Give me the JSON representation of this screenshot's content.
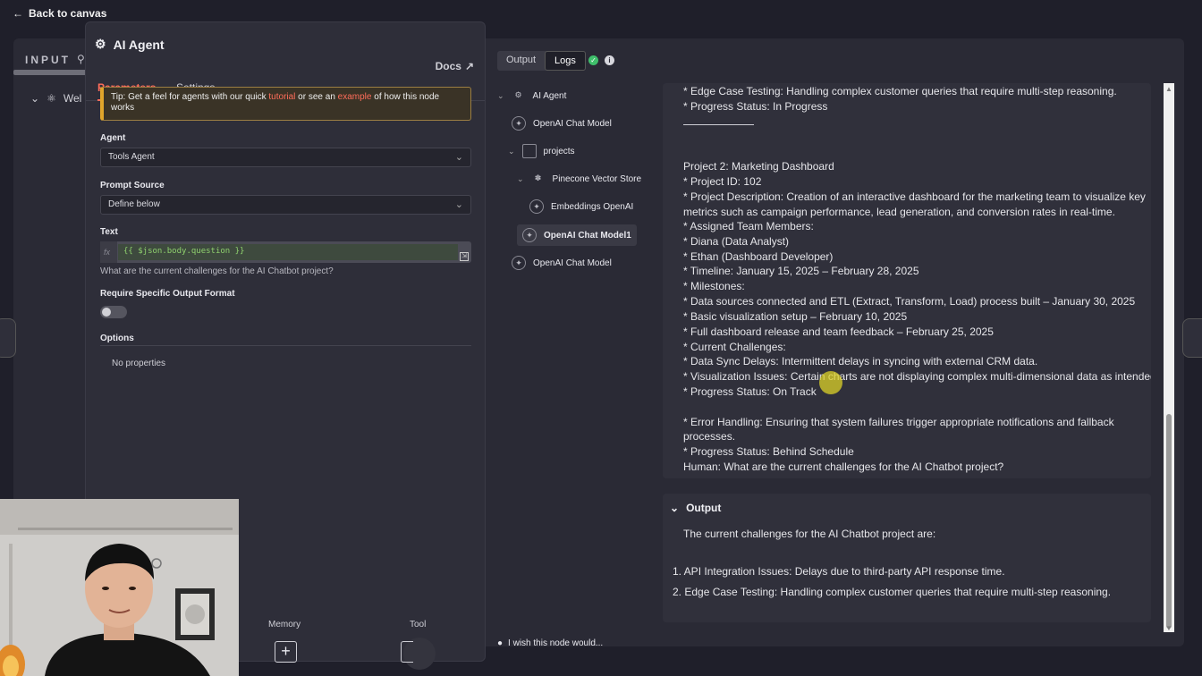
{
  "nav": {
    "back_label": "Back to canvas"
  },
  "input_panel": {
    "label": "INPUT",
    "row_label": "Wel"
  },
  "node": {
    "title": "AI Agent",
    "tabs": {
      "parameters": "Parameters",
      "settings": "Settings"
    },
    "docs_label": "Docs",
    "tip": {
      "prefix": "Tip: Get a feel for agents with our quick ",
      "link1": "tutorial",
      "middle": " or see an ",
      "link2": "example",
      "suffix": " of how this node works"
    },
    "agent": {
      "label": "Agent",
      "value": "Tools Agent"
    },
    "prompt_source": {
      "label": "Prompt Source",
      "value": "Define below"
    },
    "text": {
      "label": "Text",
      "fx": "fx",
      "expression": "{{ $json.body.question }}",
      "preview": "What are the current challenges for the AI Chatbot project?"
    },
    "require_format": {
      "label": "Require Specific Output Format"
    },
    "options": {
      "label": "Options",
      "empty": "No properties"
    },
    "memory_label": "Memory",
    "tool_label": "Tool",
    "add_symbol": "+"
  },
  "output": {
    "tabs": {
      "output": "Output",
      "logs": "Logs"
    },
    "tree": [
      {
        "label": "AI Agent"
      },
      {
        "label": "OpenAI Chat Model"
      },
      {
        "label": "projects"
      },
      {
        "label": "Pinecone Vector Store"
      },
      {
        "label": "Embeddings OpenAI"
      },
      {
        "label": "OpenAI Chat Model1"
      },
      {
        "label": "OpenAI Chat Model"
      }
    ],
    "log_lines": [
      "* Edge Case Testing: Handling complex customer queries that require multi-step reasoning.",
      "* Progress Status: In Progress",
      "Project 2: Marketing Dashboard",
      "* Project ID: 102",
      "* Project Description: Creation of an interactive dashboard for the marketing team to visualize key",
      "metrics such as campaign performance, lead generation, and conversion rates in real-time.",
      "* Assigned Team Members:",
      "* Diana (Data Analyst)",
      "* Ethan (Dashboard Developer)",
      "* Timeline: January 15, 2025 – February 28, 2025",
      "* Milestones:",
      "* Data sources connected and ETL (Extract, Transform, Load) process built – January 30, 2025",
      "* Basic visualization setup – February 10, 2025",
      "* Full dashboard release and team feedback – February 25, 2025",
      "* Current Challenges:",
      "* Data Sync Delays: Intermittent delays in syncing with external CRM data.",
      "* Visualization Issues: Certain charts are not displaying complex multi-dimensional data as intended.",
      "* Progress Status: On Track",
      "* Error Handling: Ensuring that system failures trigger appropriate notifications and fallback",
      "processes.",
      "* Progress Status: Behind Schedule",
      "Human: What are the current challenges for the AI Chatbot project?"
    ],
    "result": {
      "header": "Output",
      "intro": "The current challenges for the AI Chatbot project are:",
      "item1": "1. API Integration Issues: Delays due to third-party API response time.",
      "item2": "2. Edge Case Testing: Handling complex customer queries that require multi-step reasoning."
    },
    "feedback_label": "I wish this node would..."
  },
  "colors": {
    "accent": "#ff6d5a",
    "success": "#3fbf6b",
    "tip_border": "#e0a52b"
  }
}
